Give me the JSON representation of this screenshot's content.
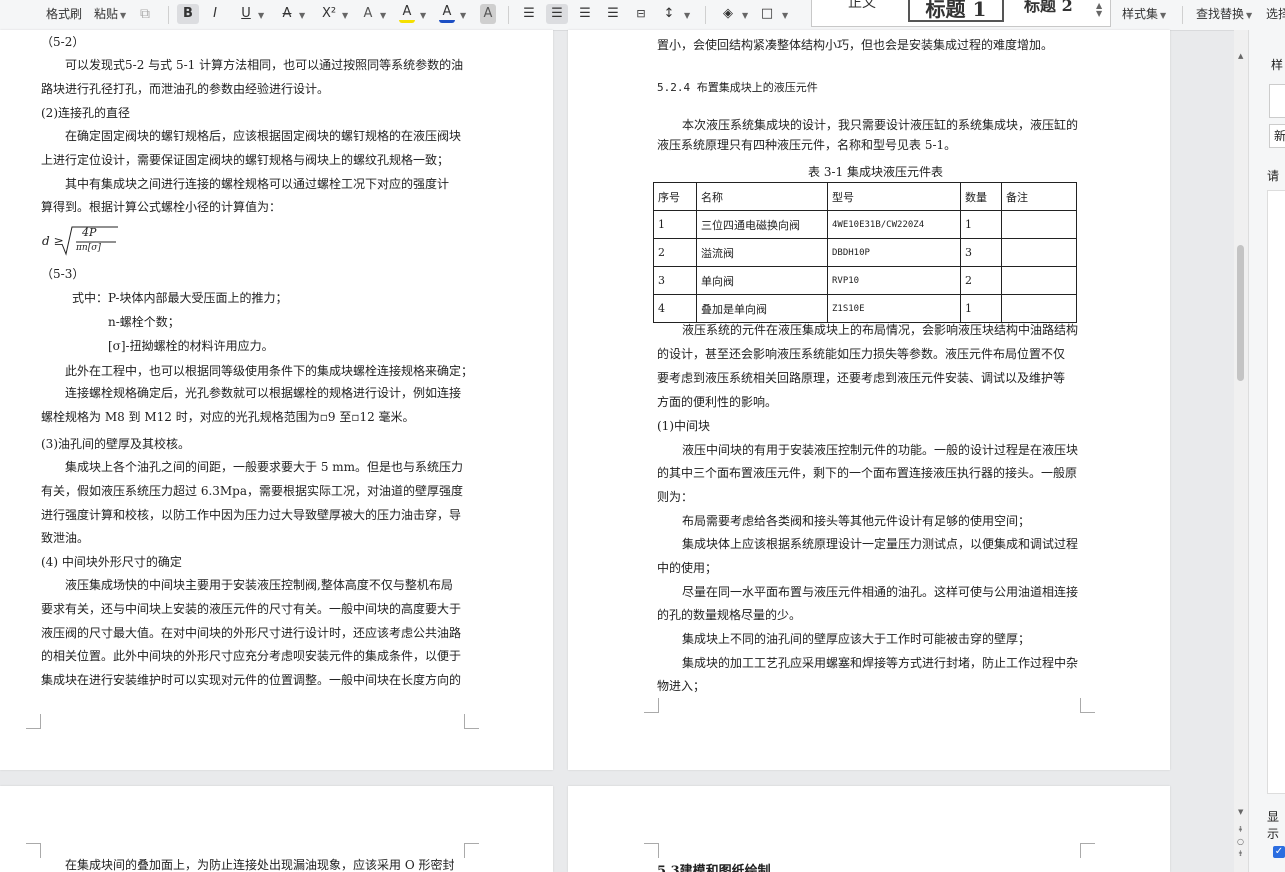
{
  "toolbar": {
    "format_painter": "格式刷",
    "paste": "粘贴",
    "bold": "B",
    "italic": "I",
    "underline": "U",
    "strikethrough": "A",
    "superscript": "X²",
    "text_effect": "A",
    "highlight": "A",
    "font_color": "A",
    "char_shading": "A",
    "styles": [
      "正文",
      "标题 1",
      "标题 2"
    ],
    "style_set": "样式集",
    "find_replace": "查找替换",
    "select": "选择"
  },
  "right_panel": {
    "title_fragment": "样",
    "new_fragment": "新",
    "please_fragment": "请",
    "show_fragment": "显示"
  },
  "page1": {
    "lines": [
      "（5-2）",
      "可以发现式5-2 与式 5-1 计算方法相同，也可以通过按照同等系统参数的油",
      "路块进行孔径打孔，而泄油孔的参数由经验进行设计。",
      "(2)连接孔的直径",
      "在确定固定阀块的螺钉规格后，应该根据固定阀块的螺钉规格的在液压阀块",
      "上进行定位设计，需要保证固定阀块的螺钉规格与阀块上的螺纹孔规格一致；",
      "其中有集成块之间进行连接的螺栓规格可以通过螺栓工况下对应的强度计",
      "算得到。根据计算公式螺栓小径的计算值为：",
      "（5-3）",
      "式中：P-块体内部最大受压面上的推力；",
      "n-螺栓个数；",
      "[σ]-扭拗螺栓的材料许用应力。",
      "此外在工程中，也可以根据同等级使用条件下的集成块螺栓连接规格来确定；",
      "连接螺栓规格确定后，光孔参数就可以根据螺栓的规格进行设计，例如连接",
      "螺栓规格为 M8 到 M12 时，对应的光孔规格范围为▫9 至▫12 毫米。",
      "(3)油孔间的壁厚及其校核。",
      "集成块上各个油孔之间的间距，一般要求要大于 5 mm。但是也与系统压力",
      "有关，假如液压系统压力超过 6.3Mpa，需要根据实际工况，对油道的壁厚强度",
      "进行强度计算和校核，以防工作中因为压力过大导致壁厚被大的压力油击穿，导",
      "致泄油。",
      "(4) 中间块外形尺寸的确定",
      "液压集成场快的中间块主要用于安装液压控制阀,整体高度不仅与整机布局",
      "要求有关，还与中间块上安装的液压元件的尺寸有关。一般中间块的高度要大于",
      "液压阀的尺寸最大值。在对中间块的外形尺寸进行设计时，还应该考虑公共油路",
      "的相关位置。此外中间块的外形尺寸应充分考虑呗安装元件的集成条件，以便于",
      "集成块在进行安装维护时可以实现对元件的位置调整。一般中间块在长度方向的"
    ],
    "formula": {
      "lhs": "d ≥",
      "numerator": "4P",
      "denominator": "πn[σ]"
    }
  },
  "page2": {
    "lines_top": [
      "置小，会使回结构紧凑整体结构小巧，但也会是安装集成过程的难度增加。",
      "5.2.4 布置集成块上的液压元件",
      "本次液压系统集成块的设计，我只需要设计液压缸的系统集成块，液压缸的",
      "液压系统原理只有四种液压元件，名称和型号见表 5-1。",
      "表 3-1   集成块液压元件表"
    ],
    "table": {
      "headers": [
        "序号",
        "名称",
        "型号",
        "数量",
        "备注"
      ],
      "rows": [
        [
          "1",
          "三位四通电磁换向阀",
          "4WE10E31B/CW220Z4",
          "1",
          ""
        ],
        [
          "2",
          "溢流阀",
          "DBDH10P",
          "3",
          ""
        ],
        [
          "3",
          "单向阀",
          "RVP10",
          "2",
          ""
        ],
        [
          "4",
          "叠加是单向阀",
          "Z1S10E",
          "1",
          ""
        ]
      ]
    },
    "lines_bottom": [
      "液压系统的元件在液压集成块上的布局情况，会影响液压块结构中油路结构",
      "的设计，甚至还会影响液压系统能如压力损失等参数。液压元件布局位置不仅",
      "要考虑到液压系统相关回路原理，还要考虑到液压元件安装、调试以及维护等",
      "方面的便利性的影响。",
      "(1)中间块",
      "液压中间块的有用于安装液压控制元件的功能。一般的设计过程是在液压块",
      "的其中三个面布置液压元件，剩下的一个面布置连接液压执行器的接头。一般原",
      "则为：",
      "布局需要考虑给各类阀和接头等其他元件设计有足够的使用空间；",
      "集成块体上应该根据系统原理设计一定量压力测试点，以便集成和调试过程",
      "中的使用；",
      "尽量在同一水平面布置与液压元件相通的油孔。这样可使与公用油道相连接",
      "的孔的数量规格尽量的少。",
      "集成块上不同的油孔间的壁厚应该大于工作时可能被击穿的壁厚；",
      "集成块的加工工艺孔应采用螺塞和焊接等方式进行封堵，防止工作过程中杂",
      "物进入；"
    ]
  },
  "page3": {
    "line": "在集成块间的叠加面上，为防止连接处出现漏油现象，应该采用 O 形密封"
  },
  "page4": {
    "line": "5.3建模和图纸绘制"
  }
}
